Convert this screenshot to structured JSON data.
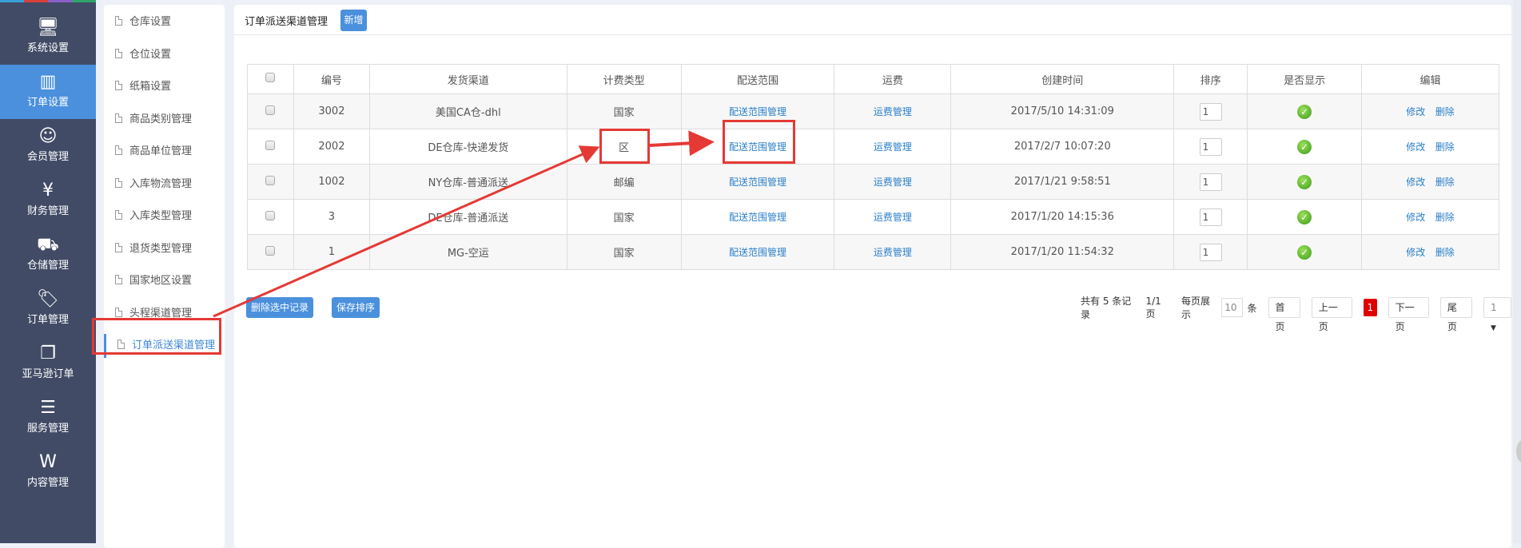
{
  "sidebar": {
    "items": [
      {
        "label": "系统设置",
        "icon": "monitor-gear-icon"
      },
      {
        "label": "订单设置",
        "icon": "order-settings-icon",
        "active": true
      },
      {
        "label": "会员管理",
        "icon": "user-icon"
      },
      {
        "label": "财务管理",
        "icon": "money-bag-icon"
      },
      {
        "label": "仓储管理",
        "icon": "warehouse-truck-icon"
      },
      {
        "label": "订单管理",
        "icon": "tag-icon"
      },
      {
        "label": "亚马逊订单",
        "icon": "document-copy-icon"
      },
      {
        "label": "服务管理",
        "icon": "notepad-icon"
      },
      {
        "label": "内容管理",
        "icon": "word-icon"
      }
    ]
  },
  "submenu": {
    "items": [
      "仓库设置",
      "仓位设置",
      "纸箱设置",
      "商品类别管理",
      "商品单位管理",
      "入库物流管理",
      "入库类型管理",
      "退货类型管理",
      "国家地区设置",
      "头程渠道管理",
      "订单派送渠道管理"
    ],
    "active_index": 10
  },
  "main": {
    "title": "订单派送渠道管理",
    "add_label": "新增",
    "columns": [
      "编号",
      "发货渠道",
      "计费类型",
      "配送范围",
      "运费",
      "创建时间",
      "排序",
      "是否显示",
      "编辑"
    ],
    "rows": [
      {
        "id": "3002",
        "channel": "美国CA仓-dhl",
        "billing": "国家",
        "range": "配送范围管理",
        "freight": "运费管理",
        "created": "2017/5/10 14:31:09",
        "sort": "1",
        "visible": true,
        "edit": "修改",
        "del": "删除"
      },
      {
        "id": "2002",
        "channel": "DE仓库-快递发货",
        "billing": "区",
        "range": "配送范围管理",
        "freight": "运费管理",
        "created": "2017/2/7 10:07:20",
        "sort": "1",
        "visible": true,
        "edit": "修改",
        "del": "删除"
      },
      {
        "id": "1002",
        "channel": "NY仓库-普通派送",
        "billing": "邮编",
        "range": "配送范围管理",
        "freight": "运费管理",
        "created": "2017/1/21 9:58:51",
        "sort": "1",
        "visible": true,
        "edit": "修改",
        "del": "删除"
      },
      {
        "id": "3",
        "channel": "DE仓库-普通派送",
        "billing": "国家",
        "range": "配送范围管理",
        "freight": "运费管理",
        "created": "2017/1/20 14:15:36",
        "sort": "1",
        "visible": true,
        "edit": "修改",
        "del": "删除"
      },
      {
        "id": "1",
        "channel": "MG-空运",
        "billing": "国家",
        "range": "配送范围管理",
        "freight": "运费管理",
        "created": "2017/1/20 11:54:32",
        "sort": "1",
        "visible": true,
        "edit": "修改",
        "del": "删除"
      }
    ],
    "delete_selected_label": "删除选中记录",
    "save_sort_label": "保存排序"
  },
  "pager": {
    "total_text": "共有 5 条记录",
    "page_text": "1/1 页",
    "per_page_label": "每页展示",
    "per_page": "10",
    "unit": "条",
    "first": "首页",
    "prev": "上一页",
    "current": "1",
    "next": "下一页",
    "last": "尾页",
    "jump": "1"
  },
  "colors": {
    "sidebar": "#414b66",
    "accent": "#4a90dd",
    "annotation": "#e53935",
    "current_page": "#e10000"
  }
}
